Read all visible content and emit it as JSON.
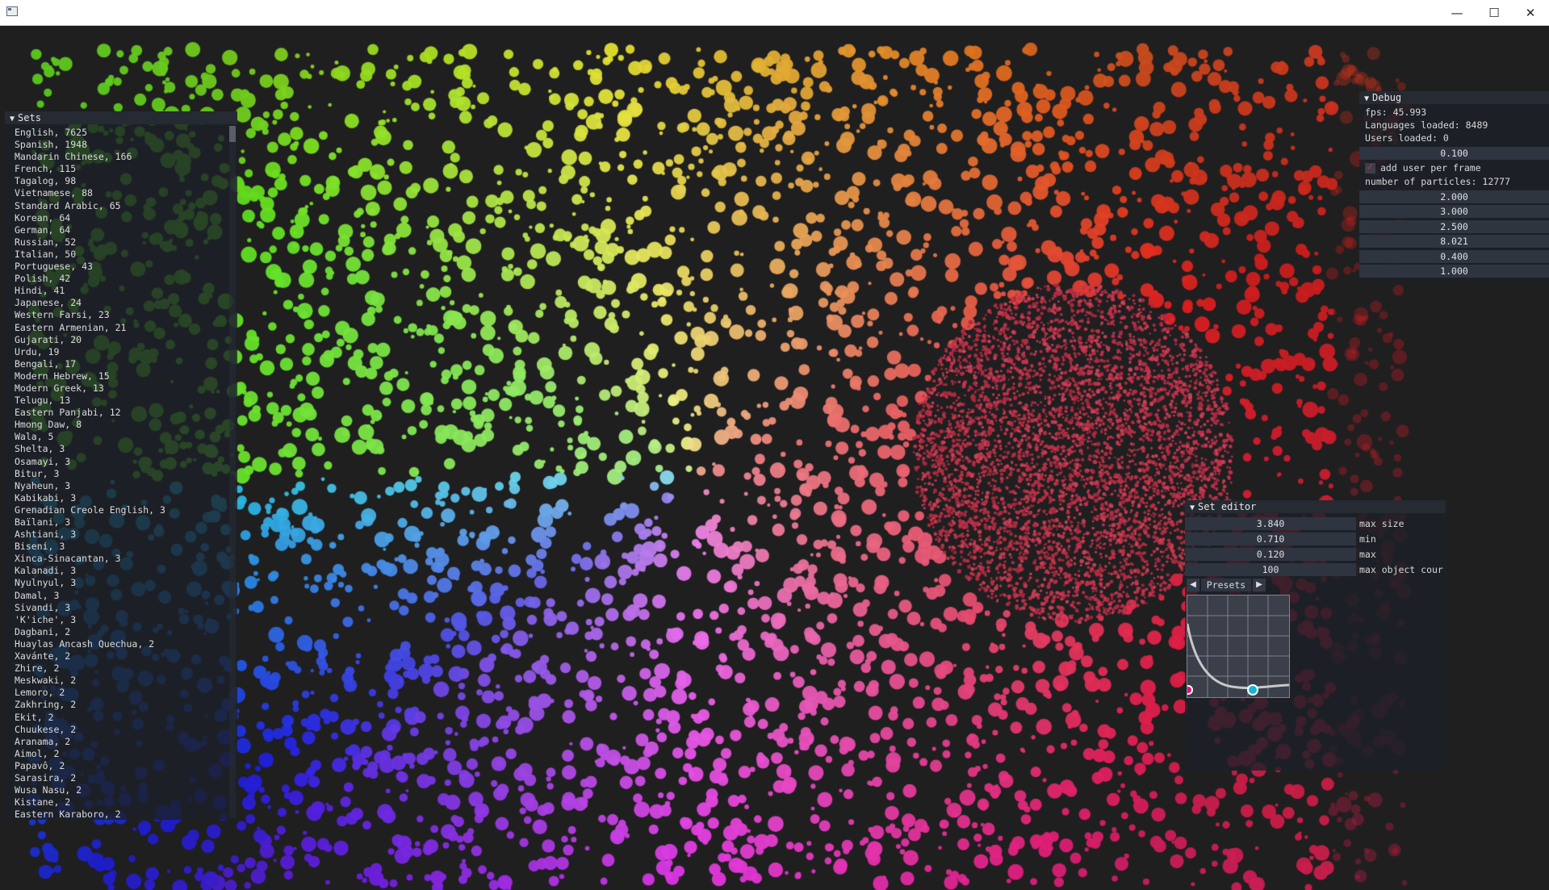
{
  "window": {
    "title": "",
    "minimize_glyph": "—",
    "maximize_glyph": "☐",
    "close_glyph": "✕"
  },
  "sets_panel": {
    "title": "Sets",
    "collapse_glyph": "▼",
    "items": [
      "English, 7625",
      "Spanish, 1948",
      "Mandarin Chinese, 166",
      "French, 115",
      "Tagalog, 98",
      "Vietnamese, 88",
      "Standard Arabic, 65",
      "Korean, 64",
      "German, 64",
      "Russian, 52",
      "Italian, 50",
      "Portuguese, 43",
      "Polish, 42",
      "Hindi, 41",
      "Japanese, 24",
      "Western Farsi, 23",
      "Eastern Armenian, 21",
      "Gujarati, 20",
      "Urdu, 19",
      "Bengali, 17",
      "Modern Hebrew, 15",
      "Modern Greek, 13",
      "Telugu, 13",
      "Eastern Panjabi, 12",
      "Hmong Daw, 8",
      "Wala, 5",
      "Shelta, 3",
      "Osamayi, 3",
      "Bitur, 3",
      "Nyaheun, 3",
      "Kabikabi, 3",
      "Grenadian Creole English, 3",
      "Baïlani, 3",
      "Ashtiani, 3",
      "Biseni, 3",
      "Xinca-Sinacantan, 3",
      "Kalanadi, 3",
      "Nyulnyul, 3",
      "Damal, 3",
      "Sivandi, 3",
      "'K'iche', 3",
      "Dagbani, 2",
      "Huaylas Ancash Quechua, 2",
      "Xavánte, 2",
      "Zhire, 2",
      "Meskwaki, 2",
      "Lemoro, 2",
      "Zakhring, 2",
      "Ekit, 2",
      "Chuukese, 2",
      "Aranama, 2",
      "Aimol, 2",
      "Papavô, 2",
      "Sarasira, 2",
      "Wusa Nasu, 2",
      "Kistane, 2",
      "Eastern Karaboro, 2"
    ]
  },
  "debug_panel": {
    "title": "Debug",
    "collapse_glyph": "▼",
    "fps": "fps: 45.993",
    "languages_loaded": "Languages loaded: 8489",
    "users_loaded": "Users loaded: 0",
    "field_1": "0.100",
    "add_user_label": "add user per frame",
    "add_user_checked": true,
    "particles": "number of particles: 12777",
    "fields": [
      "2.000",
      "3.000",
      "2.500",
      "8.021",
      "0.400",
      "1.000"
    ]
  },
  "set_editor": {
    "title": "Set editor",
    "collapse_glyph": "▼",
    "rows": [
      {
        "value": "3.840",
        "label": "max size"
      },
      {
        "value": "0.710",
        "label": "min"
      },
      {
        "value": "0.120",
        "label": "max"
      },
      {
        "value": "100",
        "label": "max object cour"
      }
    ],
    "presets_label": "Presets",
    "prev_glyph": "◀",
    "next_glyph": "▶",
    "curve_start_color": "#e0157e",
    "curve_end_color": "#15b5d8"
  },
  "colors": {
    "background": "#1f1f20",
    "panel": "#1c2028",
    "accent_red": "#e03a2c"
  }
}
